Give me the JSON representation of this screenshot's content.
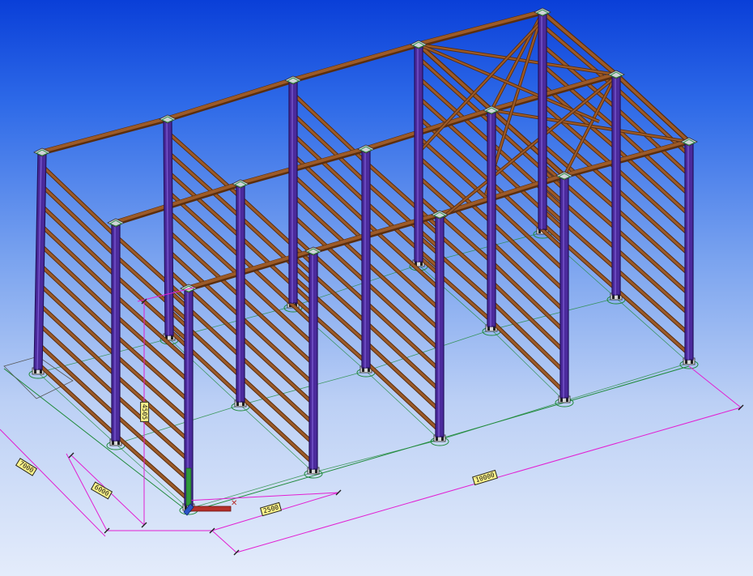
{
  "viewport": {
    "name": "3d-model-viewport",
    "colors": {
      "column": "#4b2a9c",
      "column_edge": "#23105e",
      "beam": "#9c5a28",
      "beam_edge": "#5a2e0e",
      "dimension": "#e21fd2",
      "grid": "#1f8a3a",
      "base": "#2a2a2a",
      "axis_x": "#b5302a",
      "axis_y": "#2e9a3a",
      "axis_z": "#2a55c8"
    }
  },
  "dimensions": [
    {
      "id": "dim-height",
      "label": "4505"
    },
    {
      "id": "dim-bay-span",
      "label": "6000"
    },
    {
      "id": "dim-bay",
      "label": "2500"
    },
    {
      "id": "dim-total-length",
      "label": "10000"
    },
    {
      "id": "dim-total-width",
      "label": "7000"
    }
  ]
}
